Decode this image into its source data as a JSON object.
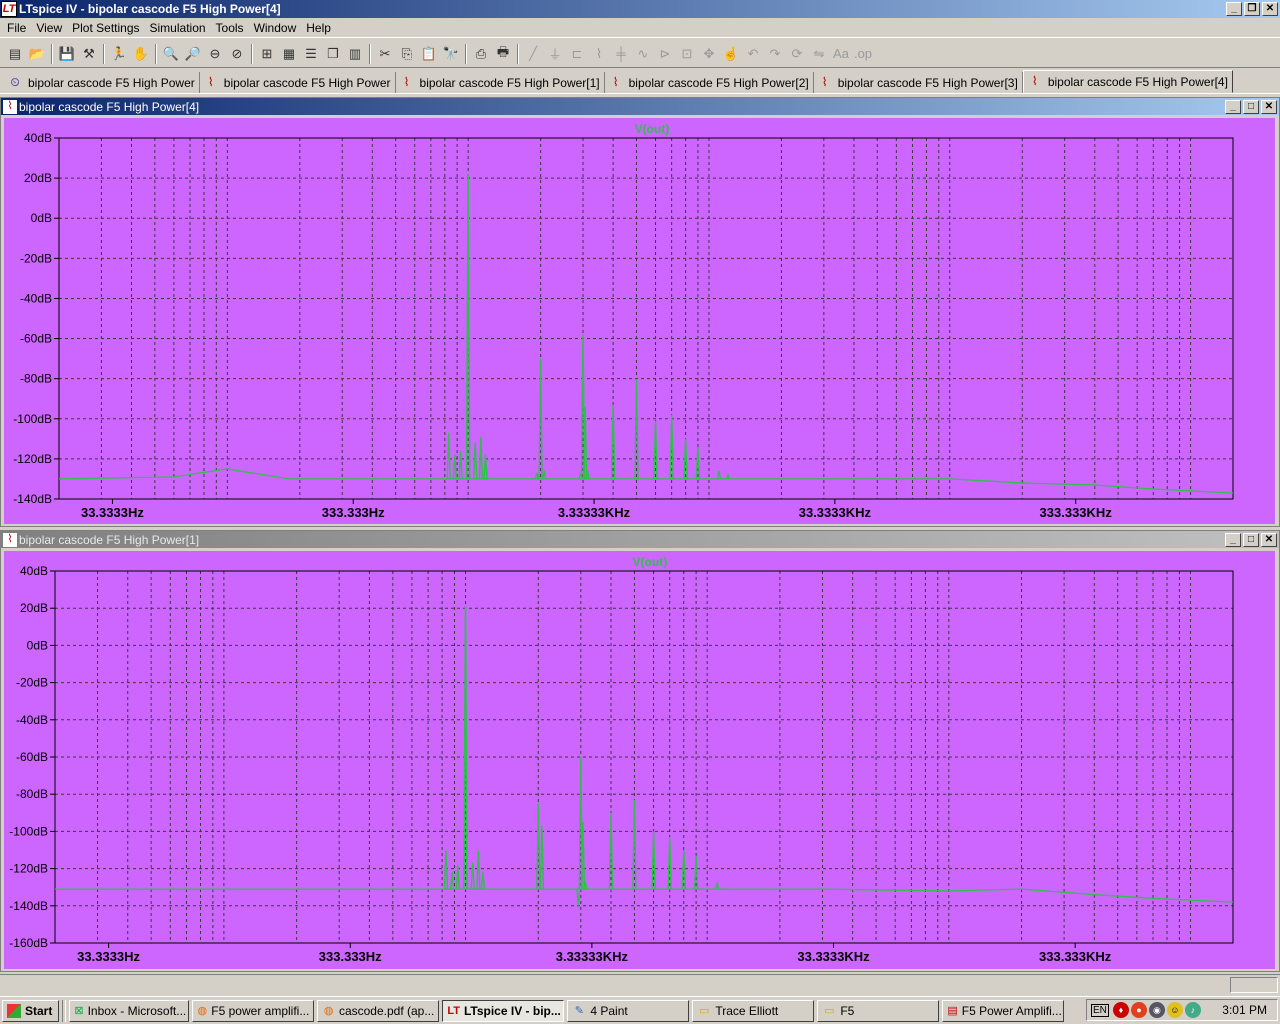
{
  "window": {
    "title": "LTspice IV - bipolar cascode F5 High Power[4]",
    "app_icon": "ltspice-logo-icon"
  },
  "menu": [
    "File",
    "View",
    "Plot Settings",
    "Simulation",
    "Tools",
    "Window",
    "Help"
  ],
  "toolbar": [
    "new-schematic-icon",
    "open-icon",
    "save-icon",
    "control-panel-icon",
    "run-icon",
    "halt-icon",
    "zoom-in-icon",
    "zoom-in-area-icon",
    "zoom-out-icon",
    "zoom-cancel-icon",
    "autorange-icon",
    "grid-icon",
    "tile-horizontal-icon",
    "cascade-icon",
    "tile-vertical-icon",
    "cut-icon",
    "copy-icon",
    "paste-icon",
    "find-icon",
    "print-preview-icon",
    "print-icon",
    "wire-icon",
    "ground-icon",
    "label-icon",
    "resistor-icon",
    "capacitor-icon",
    "inductor-icon",
    "diode-icon",
    "component-icon",
    "move-icon",
    "drag-icon",
    "undo-icon",
    "redo-icon",
    "rotate-icon",
    "mirror-icon",
    "text-icon",
    "spice-directive-icon"
  ],
  "tabs": [
    {
      "label": "bipolar cascode F5 High Power",
      "kind": "schematic"
    },
    {
      "label": "bipolar cascode F5 High Power",
      "kind": "waveform"
    },
    {
      "label": "bipolar cascode F5 High Power[1]",
      "kind": "waveform"
    },
    {
      "label": "bipolar cascode F5 High Power[2]",
      "kind": "waveform"
    },
    {
      "label": "bipolar cascode F5 High Power[3]",
      "kind": "waveform"
    },
    {
      "label": "bipolar cascode F5 High Power[4]",
      "kind": "waveform",
      "active": true
    }
  ],
  "panes": [
    {
      "title": "bipolar cascode F5 High Power[4]",
      "active": true
    },
    {
      "title": "bipolar cascode F5 High Power[1]",
      "active": false
    }
  ],
  "colors": {
    "plot_bg": "#cc66ff",
    "trace": "#2fbf4a",
    "grid": "#3a3a3a",
    "title_active": "#0a246a",
    "title_inactive": "#808080"
  },
  "chart_data": [
    {
      "type": "line",
      "title": "V(out)",
      "x_scale": "log",
      "xlim": [
        20,
        1500000
      ],
      "x_ticks": [
        "33.3333Hz",
        "333.333Hz",
        "3.33333KHz",
        "33.3333KHz",
        "333.333KHz"
      ],
      "x_tick_values": [
        33.3333,
        333.333,
        3333.33,
        33333.3,
        333333
      ],
      "ylim": [
        -140,
        40
      ],
      "y_ticks": [
        "40dB",
        "20dB",
        "0dB",
        "-20dB",
        "-40dB",
        "-60dB",
        "-80dB",
        "-100dB",
        "-120dB",
        "-140dB"
      ],
      "y_tick_values": [
        40,
        20,
        0,
        -20,
        -40,
        -60,
        -80,
        -100,
        -120,
        -140
      ],
      "floor": [
        [
          20,
          -130
        ],
        [
          60,
          -129
        ],
        [
          100,
          -125
        ],
        [
          180,
          -130
        ],
        [
          1000,
          -130
        ],
        [
          30000,
          -130
        ],
        [
          100000,
          -130
        ],
        [
          200000,
          -132
        ],
        [
          400000,
          -133
        ],
        [
          700000,
          -135
        ],
        [
          1500000,
          -137
        ]
      ],
      "peaks": [
        {
          "f": 830,
          "db": -107
        },
        {
          "f": 880,
          "db": -118
        },
        {
          "f": 930,
          "db": -116
        },
        {
          "f": 1000,
          "db": 22
        },
        {
          "f": 1070,
          "db": -112
        },
        {
          "f": 1130,
          "db": -109
        },
        {
          "f": 1180,
          "db": -118
        },
        {
          "f": 1930,
          "db": -127
        },
        {
          "f": 2000,
          "db": -70
        },
        {
          "f": 2070,
          "db": -126
        },
        {
          "f": 2930,
          "db": -127
        },
        {
          "f": 3000,
          "db": -58
        },
        {
          "f": 3060,
          "db": -94
        },
        {
          "f": 3130,
          "db": -126
        },
        {
          "f": 4000,
          "db": -93
        },
        {
          "f": 5000,
          "db": -80
        },
        {
          "f": 6000,
          "db": -101
        },
        {
          "f": 7000,
          "db": -98
        },
        {
          "f": 8000,
          "db": -110
        },
        {
          "f": 9000,
          "db": -114
        },
        {
          "f": 11000,
          "db": -126
        },
        {
          "f": 12000,
          "db": -128
        }
      ]
    },
    {
      "type": "line",
      "title": "V(out)",
      "x_scale": "log",
      "xlim": [
        20,
        1500000
      ],
      "x_ticks": [
        "33.3333Hz",
        "333.333Hz",
        "3.33333KHz",
        "33.3333KHz",
        "333.333KHz"
      ],
      "x_tick_values": [
        33.3333,
        333.333,
        3333.33,
        33333.3,
        333333
      ],
      "ylim": [
        -160,
        40
      ],
      "y_ticks": [
        "40dB",
        "20dB",
        "0dB",
        "-20dB",
        "-40dB",
        "-60dB",
        "-80dB",
        "-100dB",
        "-120dB",
        "-140dB",
        "-160dB"
      ],
      "y_tick_values": [
        40,
        20,
        0,
        -20,
        -40,
        -60,
        -80,
        -100,
        -120,
        -140,
        -160
      ],
      "floor": [
        [
          20,
          -131
        ],
        [
          1000,
          -131
        ],
        [
          30000,
          -131
        ],
        [
          100000,
          -132
        ],
        [
          200000,
          -131
        ],
        [
          400000,
          -134
        ],
        [
          700000,
          -136
        ],
        [
          1500000,
          -138
        ]
      ],
      "peaks": [
        {
          "f": 830,
          "db": -110
        },
        {
          "f": 880,
          "db": -122
        },
        {
          "f": 930,
          "db": -118
        },
        {
          "f": 1000,
          "db": 21
        },
        {
          "f": 1070,
          "db": -117
        },
        {
          "f": 1130,
          "db": -110
        },
        {
          "f": 1180,
          "db": -122
        },
        {
          "f": 2000,
          "db": -85
        },
        {
          "f": 2070,
          "db": -97
        },
        {
          "f": 2930,
          "db": -140
        },
        {
          "f": 3000,
          "db": -60
        },
        {
          "f": 3060,
          "db": -95
        },
        {
          "f": 3130,
          "db": -127
        },
        {
          "f": 4000,
          "db": -90
        },
        {
          "f": 5000,
          "db": -83
        },
        {
          "f": 6000,
          "db": -100
        },
        {
          "f": 7000,
          "db": -103
        },
        {
          "f": 8000,
          "db": -110
        },
        {
          "f": 9000,
          "db": -113
        },
        {
          "f": 11000,
          "db": -128
        },
        {
          "f": 12000,
          "db": -131
        }
      ]
    }
  ],
  "statusbar": {
    "text": ""
  },
  "taskbar": {
    "start": "Start",
    "tasks": [
      {
        "label": "Inbox - Microsoft...",
        "icon": "outlook-icon",
        "pressed": false
      },
      {
        "label": "F5 power amplifi...",
        "icon": "firefox-icon",
        "pressed": false
      },
      {
        "label": "cascode.pdf (ap...",
        "icon": "firefox-icon",
        "pressed": false
      },
      {
        "label": "LTspice IV - bip...",
        "icon": "ltspice-logo-icon",
        "pressed": true
      },
      {
        "label": "4 Paint",
        "icon": "paint-icon",
        "pressed": false
      },
      {
        "label": "Trace Elliott",
        "icon": "folder-icon",
        "pressed": false
      },
      {
        "label": "F5",
        "icon": "folder-icon",
        "pressed": false
      },
      {
        "label": "F5 Power Amplifi...",
        "icon": "pdf-icon",
        "pressed": false
      }
    ],
    "tray": {
      "lang": "EN",
      "clock": "3:01 PM"
    }
  }
}
